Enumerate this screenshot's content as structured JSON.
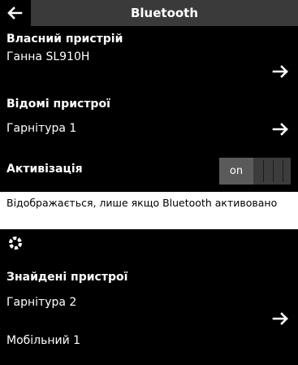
{
  "header": {
    "title": "Bluetooth",
    "back_icon": "arrow-left-icon"
  },
  "own_device": {
    "heading": "Власний пристрій",
    "name": "Ганна SL910H"
  },
  "known_devices": {
    "heading": "Відомі пристрої",
    "items": [
      "Гарнітура 1"
    ]
  },
  "activation": {
    "label": "Активізація",
    "toggle_text": "on",
    "state": "on"
  },
  "note": {
    "text": "Відображається, лише якщо Bluetooth активовано"
  },
  "search": {
    "spinner_icon": "loading-spinner-icon"
  },
  "found_devices": {
    "heading": "Знайдені пристрої",
    "items": [
      "Гарнітура 2",
      "Мобільний 1"
    ]
  },
  "colors": {
    "background": "#000000",
    "title_bar": "#3a3a3a",
    "toggle_on": "#5a5a5a",
    "note_background": "#ffffff"
  }
}
